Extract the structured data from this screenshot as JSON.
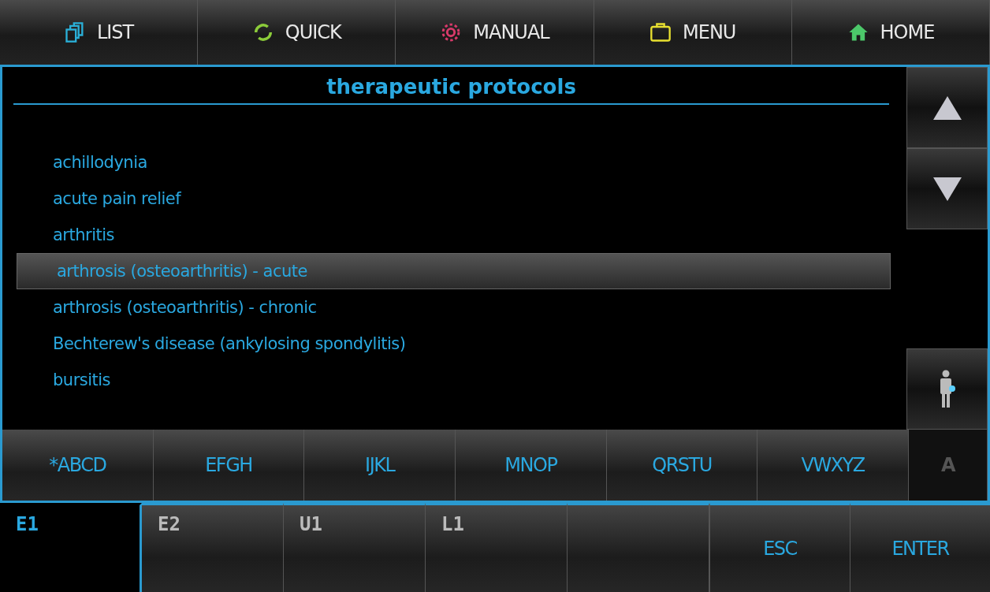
{
  "toolbar": [
    {
      "kind": "list",
      "label": "LIST"
    },
    {
      "kind": "quick",
      "label": "QUICK"
    },
    {
      "kind": "manual",
      "label": "MANUAL"
    },
    {
      "kind": "menu",
      "label": "MENU"
    },
    {
      "kind": "home",
      "label": "HOME"
    }
  ],
  "list": {
    "title": "therapeutic protocols",
    "items": [
      {
        "label": "achillodynia",
        "selected": false
      },
      {
        "label": "acute pain relief",
        "selected": false
      },
      {
        "label": "arthritis",
        "selected": false
      },
      {
        "label": "arthrosis (osteoarthritis) - acute",
        "selected": true
      },
      {
        "label": "arthrosis (osteoarthritis) - chronic",
        "selected": false
      },
      {
        "label": "Bechterew's disease (ankylosing spondylitis)",
        "selected": false
      },
      {
        "label": "bursitis",
        "selected": false
      }
    ]
  },
  "letters": [
    {
      "label": "*ABCD",
      "disabled": false
    },
    {
      "label": "EFGH",
      "disabled": false
    },
    {
      "label": "IJKL",
      "disabled": false
    },
    {
      "label": "MNOP",
      "disabled": false
    },
    {
      "label": "QRSTU",
      "disabled": false
    },
    {
      "label": "VWXYZ",
      "disabled": false
    },
    {
      "label": "A",
      "disabled": true
    }
  ],
  "channels": [
    {
      "label": "E1",
      "selected": true
    },
    {
      "label": "E2",
      "selected": false
    },
    {
      "label": "U1",
      "selected": false
    },
    {
      "label": "L1",
      "selected": false
    }
  ],
  "actions": [
    "ESC",
    "ENTER"
  ]
}
